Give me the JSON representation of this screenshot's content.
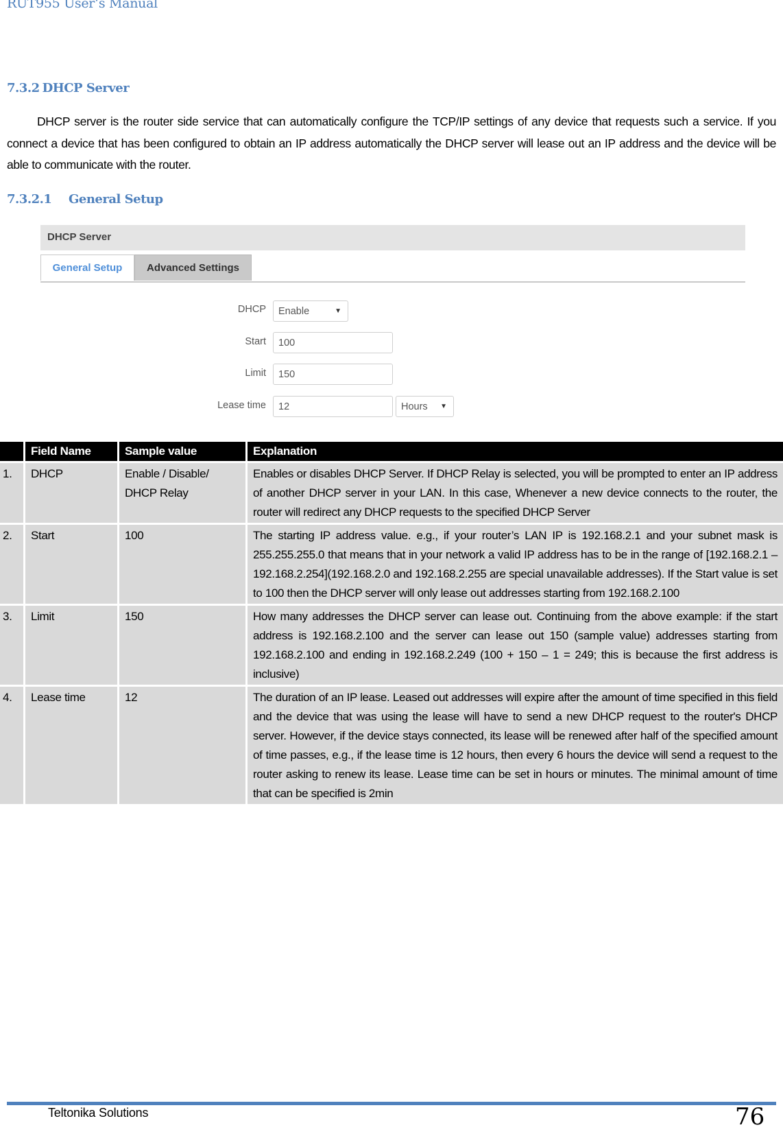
{
  "running_header": "RUT955 User‘s Manual",
  "section": {
    "number": "7.3.2",
    "title": "DHCP Server",
    "intro": "DHCP server is the router side service that can automatically configure the TCP/IP settings of any device that requests such a service. If you connect a device that has been configured to obtain an IP address automatically the DHCP server will lease out an IP address and the device will be able to communicate with the router."
  },
  "subsection": {
    "number": "7.3.2.1",
    "title": "General Setup"
  },
  "ui_screenshot": {
    "panel_title": "DHCP Server",
    "tabs": [
      {
        "label": "General Setup",
        "active": true
      },
      {
        "label": "Advanced Settings",
        "active": false
      }
    ],
    "fields": {
      "dhcp": {
        "label": "DHCP",
        "value": "Enable"
      },
      "start": {
        "label": "Start",
        "value": "100"
      },
      "limit": {
        "label": "Limit",
        "value": "150"
      },
      "lease_time": {
        "label": "Lease time",
        "value": "12",
        "unit": "Hours"
      }
    }
  },
  "table": {
    "headers": [
      "",
      "Field Name",
      "Sample value",
      "Explanation"
    ],
    "rows": [
      {
        "num": "1.",
        "field": "DHCP",
        "sample": "Enable / Disable/ DHCP Relay",
        "explanation": "Enables or disables DHCP Server. If DHCP Relay is selected, you will be prompted to enter an IP address of another DHCP server in your LAN. In this case, Whenever a new device connects to the router, the router will redirect any DHCP requests to the specified DHCP Server"
      },
      {
        "num": "2.",
        "field": "Start",
        "sample": "100",
        "explanation": "The starting IP address value. e.g., if your router’s LAN IP is 192.168.2.1 and your subnet mask is 255.255.255.0 that means that in your network a valid IP address has to be in the range of [192.168.2.1 – 192.168.2.254](192.168.2.0 and 192.168.2.255 are special unavailable addresses). If the Start value is set to 100 then the DHCP server will only lease out addresses starting from 192.168.2.100"
      },
      {
        "num": "3.",
        "field": "Limit",
        "sample": "150",
        "explanation": "How many addresses the DHCP server can lease out. Continuing from the above example: if the start address is 192.168.2.100 and the server can lease out 150 (sample value) addresses starting from 192.168.2.100 and ending in 192.168.2.249 (100 + 150 – 1 = 249; this is because the first address is inclusive)"
      },
      {
        "num": "4.",
        "field": "Lease time",
        "sample": "12",
        "explanation": "The duration of an IP lease. Leased out addresses will expire after the amount of time specified in this field and the device that was using the lease will have to send a new DHCP request to the router's DHCP server. However, if the device stays connected, its lease will be renewed after half of the specified amount of time passes, e.g., if the lease time is 12 hours, then every 6 hours the device will send a request to the router asking to renew its lease. Lease time can be set in hours or minutes. The minimal amount of time that can be specified is 2min"
      }
    ]
  },
  "footer": {
    "company": "Teltonika Solutions",
    "page_number": "76"
  },
  "colors": {
    "heading_blue": "#4f81bd",
    "table_header_bg": "#000000",
    "table_cell_bg": "#d9d9d9",
    "active_tab_text": "#4f8fd9"
  }
}
